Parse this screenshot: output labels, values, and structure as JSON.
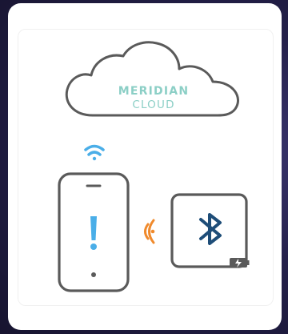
{
  "cloud": {
    "brand_line1": "MERIDIAN",
    "brand_line2": "CLOUD"
  },
  "icons": {
    "cloud": "cloud-icon",
    "wifi": "wifi-icon",
    "phone": "smartphone-icon",
    "alert": "exclamation-icon",
    "signal": "nfc-signal-icon",
    "bluetooth": "bluetooth-icon",
    "battery": "battery-charging-icon"
  },
  "colors": {
    "page_background": "#1d1a3c",
    "card": "#ffffff",
    "outline": "#5a5a5a",
    "cloud_text": "#8ccfc6",
    "wifi": "#4aaee8",
    "alert": "#4aaee8",
    "signal": "#f08a2c",
    "bluetooth": "#1e4d78"
  }
}
